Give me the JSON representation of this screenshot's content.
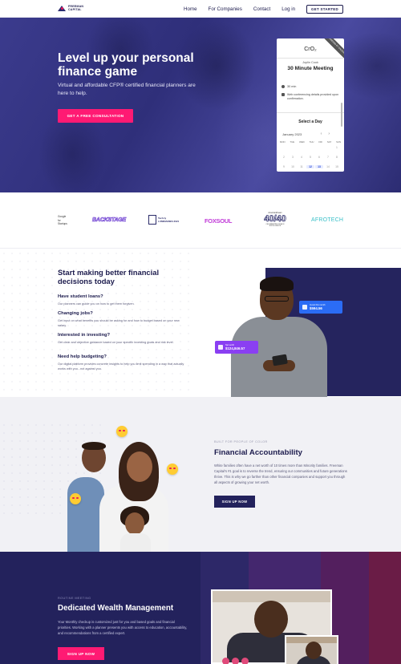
{
  "nav": {
    "logo_line1": "FREEMAN",
    "logo_line2": "CAPITAL",
    "links": [
      "Home",
      "For Companies",
      "Contact",
      "Log in"
    ],
    "cta": "GET STARTED"
  },
  "hero": {
    "title": "Level up your personal finance game",
    "subtitle": "Virtual and affordable CFP® certified financial planners are here to help.",
    "cta": "GET A FREE CONSULTATION"
  },
  "booking": {
    "ribbon": "POWERED BY CALENDLY",
    "logo": "CrO₂",
    "host": "Joplin Cook",
    "event": "30 Minute Meeting",
    "duration": "30 min",
    "web": "Web conferencing details provided upon confirmation.",
    "select_day": "Select a Day",
    "month": "January 2023",
    "prev": "‹",
    "next": "›",
    "weekdays": [
      "MON",
      "TUE",
      "WED",
      "THU",
      "FRI",
      "SAT",
      "SUN"
    ],
    "week1": [
      "",
      "",
      "",
      "",
      "",
      "",
      "1"
    ],
    "week2": [
      "2",
      "3",
      "4",
      "5",
      "6",
      "7",
      "8"
    ],
    "week3": [
      "9",
      "10",
      "11",
      "12",
      "13",
      "14",
      "15"
    ]
  },
  "brands": {
    "b1_line1": "Google",
    "b1_line2": "for",
    "b1_line3": "Startups",
    "b2": "BACKSTAGE",
    "b3_line1": "Tech.ly",
    "b3_line2": "LUMINARIES 2021",
    "b4": "FOXSOUL",
    "b5_top": "AmericanDream",
    "b5_num": "40/40",
    "b5_bottom": "CELEBRATING BLACK EXCELLENCE",
    "b6": "AFROTECH"
  },
  "decisions": {
    "title": "Start making better financial decisions today",
    "items": [
      {
        "q": "Have student loans?",
        "a": "Our planners can guide you on how to get them forgiven."
      },
      {
        "q": "Changing jobs?",
        "a": "Get input on what benefits you should be asking for and how to budget based on your new salary."
      },
      {
        "q": "Interested in investing?",
        "a": "Get clear and objective guidance based on your specific investing goals and risk level."
      },
      {
        "q": "Need help budgeting?",
        "a": "Our digital platform provides concrete insights to help you limit spending in a way that actually works with you...not against you."
      }
    ],
    "badge1_label": "Invest this month",
    "badge1_value": "$594.56",
    "badge2_label": "Net worth",
    "badge2_value": "$124,846.57"
  },
  "accountability": {
    "kicker": "BUILT FOR PEOPLE OF COLOR",
    "title": "Financial  Accountability",
    "body": "White families often have a net worth of 10 times more than Minority families. Freeman Capital's #1 goal is to reverse the trend, ensuring our communities  and future generations thrive. This is why we go farther than other financial companies and support you through all aspects of growing your net worth.",
    "cta": "SIGN UP NOW"
  },
  "wealth": {
    "kicker": "ROUTINE MEETING",
    "title": "Dedicated Wealth Management",
    "body": "Your Monthly checkup is customized just for you and based goals and financial priorities. Working with a planner presents you with access to education, accountability, and recommendations from a certified expert.",
    "cta": "SIGN UP NOW"
  },
  "colors": {
    "navy": "#23225c",
    "pink": "#ff1a73",
    "blue_badge": "#2b6cf5",
    "purple_badge": "#8a3ff2"
  }
}
